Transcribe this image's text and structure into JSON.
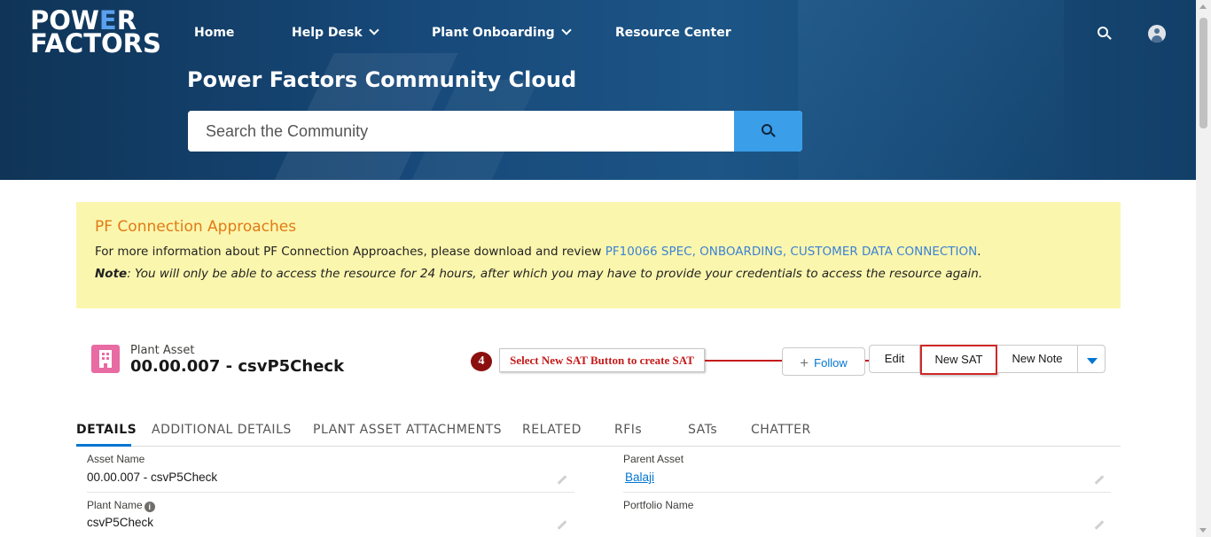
{
  "logo": {
    "line1_pre": "POW",
    "line1_e": "E",
    "line1_post": "R",
    "line2": "FACTORS"
  },
  "nav": {
    "home": "Home",
    "help_desk": "Help Desk",
    "plant_onboarding": "Plant Onboarding",
    "resource_center": "Resource Center"
  },
  "hero": {
    "title": "Power Factors Community Cloud",
    "search_placeholder": "Search the Community"
  },
  "notice": {
    "title": "PF Connection Approaches",
    "line1_text": "For more information about PF Connection Approaches, please download and review ",
    "line1_link": "PF10066 SPEC, ONBOARDING, CUSTOMER DATA CONNECTION",
    "line1_end": ".",
    "note_label": "Note",
    "note_text": ": You will only be able to access the resource for 24 hours, after which you may have to provide your credentials to access the resource again."
  },
  "record": {
    "type": "Plant Asset",
    "name": "00.00.007 - csvP5Check"
  },
  "annotation": {
    "number": "4",
    "text": "Select New SAT Button to create SAT"
  },
  "actions": {
    "follow": "Follow",
    "edit": "Edit",
    "new_sat": "New SAT",
    "new_note": "New Note"
  },
  "tabs": [
    "DETAILS",
    "ADDITIONAL DETAILS",
    "PLANT ASSET ATTACHMENTS",
    "RELATED",
    "RFIs",
    "SATs",
    "CHATTER"
  ],
  "fields": {
    "asset_name_label": "Asset Name",
    "asset_name_value": "00.00.007 - csvP5Check",
    "parent_asset_label": "Parent Asset",
    "parent_asset_value": "Balaji",
    "plant_name_label": "Plant Name",
    "plant_name_value": "csvP5Check",
    "portfolio_name_label": "Portfolio Name",
    "portfolio_name_value": ""
  },
  "colors": {
    "hero_bg": "#17497a",
    "brand_blue": "#0176d3",
    "notice_bg": "#fbf6ad",
    "notice_title": "#e07a16",
    "annotation_red": "#c41a1a"
  }
}
